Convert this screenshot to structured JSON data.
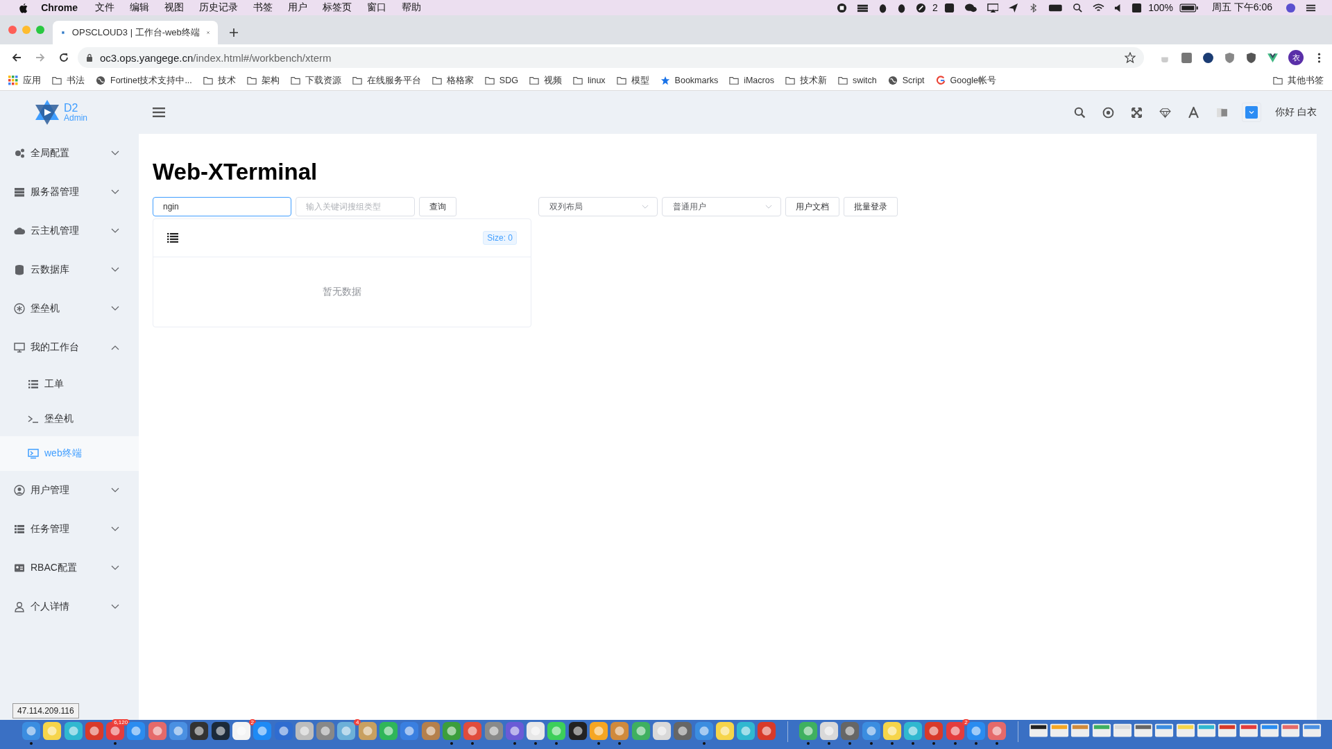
{
  "menubar": {
    "app": "Chrome",
    "menus": [
      "文件",
      "编辑",
      "视图",
      "历史记录",
      "书签",
      "用户",
      "标签页",
      "窗口",
      "帮助"
    ],
    "badge_count": "2",
    "battery": "100%",
    "clock": "周五 下午6:06"
  },
  "browser": {
    "tabs": [
      {
        "title": "OPSCLOUD3 | 工作台-web终端",
        "selected": true
      }
    ],
    "url_host": "oc3.ops.yangege.cn",
    "url_path": "/index.html#/workbench/xterm",
    "profile_initial": "衣",
    "bookmarks": [
      {
        "kind": "apps",
        "label": "应用"
      },
      {
        "kind": "folder",
        "label": "书法"
      },
      {
        "kind": "globe",
        "label": "Fortinet技术支持中..."
      },
      {
        "kind": "folder",
        "label": "技术"
      },
      {
        "kind": "folder",
        "label": "架构"
      },
      {
        "kind": "folder",
        "label": "下载资源"
      },
      {
        "kind": "folder",
        "label": "在线服务平台"
      },
      {
        "kind": "folder",
        "label": "格格家"
      },
      {
        "kind": "folder",
        "label": "SDG"
      },
      {
        "kind": "folder",
        "label": "视频"
      },
      {
        "kind": "folder",
        "label": "linux"
      },
      {
        "kind": "folder",
        "label": "模型"
      },
      {
        "kind": "star",
        "label": "Bookmarks"
      },
      {
        "kind": "folder",
        "label": "iMacros"
      },
      {
        "kind": "folder",
        "label": "技术新"
      },
      {
        "kind": "folder",
        "label": "switch"
      },
      {
        "kind": "globe",
        "label": "Script"
      },
      {
        "kind": "google",
        "label": "Google帐号"
      }
    ],
    "other_bookmarks": "其他书签"
  },
  "app": {
    "logo": {
      "title": "D2",
      "subtitle": "Admin"
    },
    "greeting": "你好 白衣",
    "sidebar": [
      {
        "kind": "gears",
        "label": "全局配置",
        "expanded": false
      },
      {
        "kind": "server",
        "label": "服务器管理",
        "expanded": false
      },
      {
        "kind": "cloud",
        "label": "云主机管理",
        "expanded": false
      },
      {
        "kind": "database",
        "label": "云数据库",
        "expanded": false
      },
      {
        "kind": "bastion",
        "label": "堡垒机",
        "expanded": false
      },
      {
        "kind": "monitor",
        "label": "我的工作台",
        "expanded": true,
        "children": [
          {
            "kind": "list",
            "label": "工单",
            "selected": false
          },
          {
            "kind": "prompt",
            "label": "堡垒机",
            "selected": false
          },
          {
            "kind": "screen",
            "label": "web终端",
            "selected": true
          }
        ]
      },
      {
        "kind": "user",
        "label": "用户管理",
        "expanded": false
      },
      {
        "kind": "tasks",
        "label": "任务管理",
        "expanded": false
      },
      {
        "kind": "idcard",
        "label": "RBAC配置",
        "expanded": false
      },
      {
        "kind": "person",
        "label": "个人详情",
        "expanded": false
      }
    ],
    "page": {
      "title": "Web-XTerminal",
      "search": {
        "value": "ngin"
      },
      "keyword": {
        "placeholder": "输入关键词搜组类型"
      },
      "query_button": "查询",
      "layout_select": "双列布局",
      "user_select": "普通用户",
      "buttons": [
        "用户文档",
        "批量登录"
      ],
      "card": {
        "size": "Size: 0",
        "empty": "暂无数据"
      }
    },
    "status_tooltip": "47.114.209.116"
  },
  "dock": [
    [
      {
        "running": true
      },
      {
        "running": false
      },
      {
        "running": false
      },
      {
        "running": false
      },
      {
        "running": true,
        "badge": "6,120"
      },
      {
        "running": false
      },
      {
        "running": false
      },
      {
        "running": false
      },
      {
        "running": false
      },
      {
        "running": false
      },
      {
        "running": false,
        "badge": "2"
      },
      {
        "running": false
      },
      {
        "running": false
      },
      {
        "running": false
      },
      {
        "running": false
      },
      {
        "running": false,
        "badge": "4"
      },
      {
        "running": false
      },
      {
        "running": false
      },
      {
        "running": false
      },
      {
        "running": false
      },
      {
        "running": true
      },
      {
        "running": true
      },
      {
        "running": false
      },
      {
        "running": true
      },
      {
        "running": true
      },
      {
        "running": true
      },
      {
        "running": false
      },
      {
        "running": true
      },
      {
        "running": true
      },
      {
        "running": false
      },
      {
        "running": false
      },
      {
        "running": false
      },
      {
        "running": true
      },
      {
        "running": false
      },
      {
        "running": false
      },
      {
        "running": false
      }
    ],
    [
      {
        "running": true
      },
      {
        "running": true
      },
      {
        "running": true
      },
      {
        "running": true
      },
      {
        "running": true
      },
      {
        "running": true
      },
      {
        "running": true
      },
      {
        "running": true,
        "badge": "2"
      },
      {
        "running": true
      },
      {
        "running": true
      }
    ],
    [
      {
        "running": false
      },
      {
        "running": false
      },
      {
        "running": false
      },
      {
        "running": false
      },
      {
        "running": false
      },
      {
        "running": false
      },
      {
        "running": false
      },
      {
        "running": false
      },
      {
        "running": false
      },
      {
        "running": false
      },
      {
        "running": false
      },
      {
        "running": false
      },
      {
        "running": false
      },
      {
        "running": false
      }
    ]
  ]
}
